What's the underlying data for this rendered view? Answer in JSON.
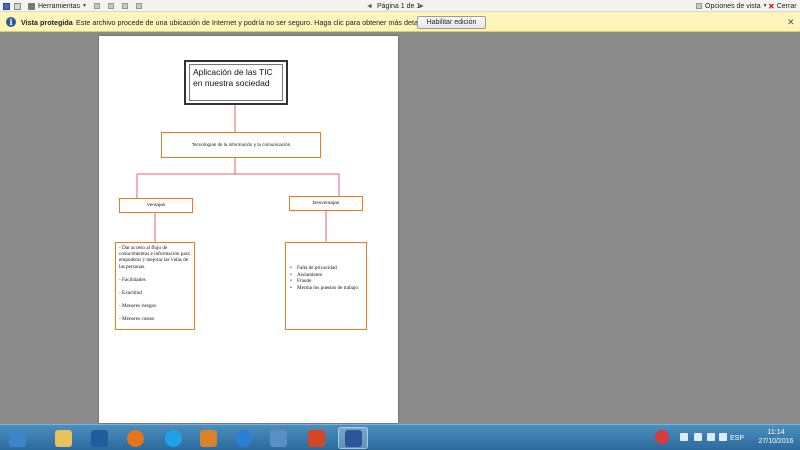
{
  "toolbar": {
    "tools_label": "Herramientas",
    "page_indicator": "Página 1 de 1",
    "view_options_label": "Opciones de vista",
    "close_label": "Cerrar"
  },
  "protected_bar": {
    "title": "Vista protegida",
    "message": "Este archivo procede de una ubicación de Internet y podría no ser seguro. Haga clic para obtener más detalles.",
    "enable_button": "Habilitar edición"
  },
  "document": {
    "title_line1": "Aplicación de las TIC",
    "title_line2": "en nuestra sociedad",
    "tic": "Tecnologías de la información y la comunicación",
    "advantages_header": "Ventajas",
    "disadvantages_header": "Desventajas",
    "advantages": [
      "- Dar acceso  al flujo de conocimientos e información para empoderar y mejorar las vidas de las personas.",
      "- Facilidades",
      "- Exactitud",
      "- Menores riesgos",
      "- Menores costos"
    ],
    "disadvantages": [
      "Falta de privacidad",
      "Aislamiento",
      "Fraude",
      "Merma los puestos de trabajo"
    ],
    "bullet": "•",
    "connector_color": "#e06666",
    "box_border_color": "#ef7a22"
  },
  "taskbar": {
    "language": "ESP",
    "time": "11:14",
    "date": "27/10/2016",
    "apps": [
      {
        "name": "start",
        "color": "#3a86c8"
      },
      {
        "name": "file-explorer",
        "color": "#e8c15a"
      },
      {
        "name": "desktop",
        "color": "#1f5d9b"
      },
      {
        "name": "firefox",
        "color": "#e5741c"
      },
      {
        "name": "skype",
        "color": "#1ea1e6"
      },
      {
        "name": "app-orange",
        "color": "#d9822b"
      },
      {
        "name": "internet-explorer",
        "color": "#2a7fd4"
      },
      {
        "name": "photos",
        "color": "#5a8fc4"
      },
      {
        "name": "powerpoint",
        "color": "#d24726"
      },
      {
        "name": "word",
        "color": "#2b579a"
      }
    ]
  }
}
